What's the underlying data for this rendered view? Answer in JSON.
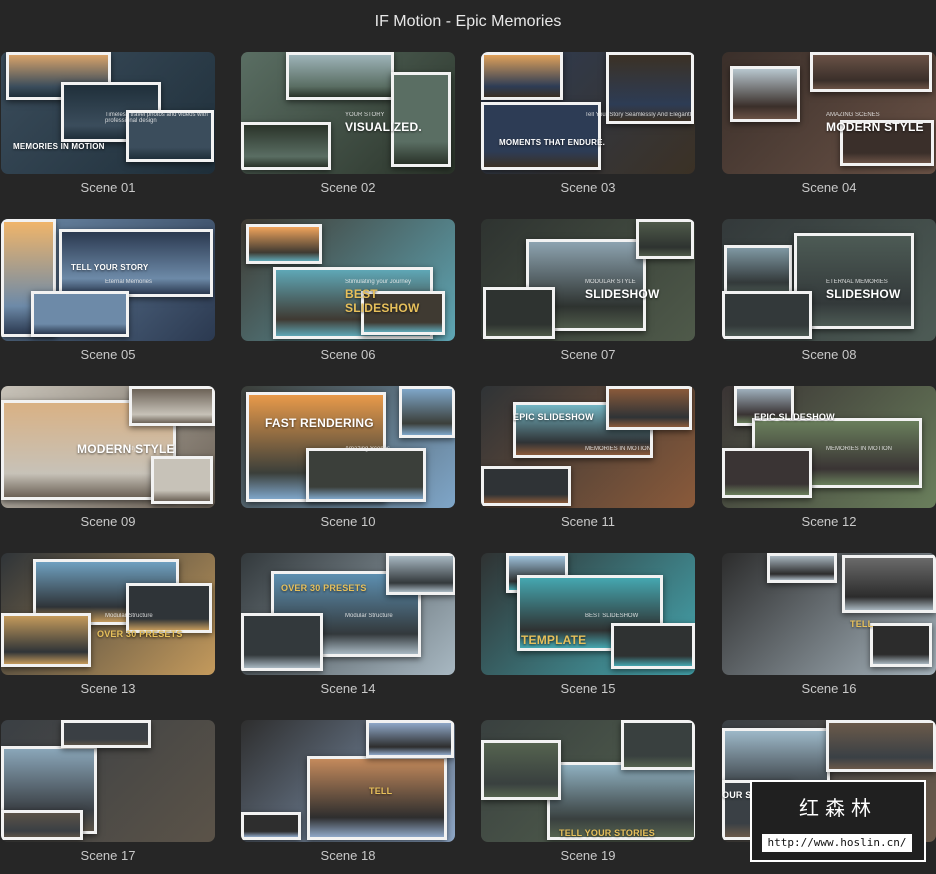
{
  "window": {
    "title": "IF Motion - Epic Memories"
  },
  "scenes": [
    {
      "label": "Scene 01",
      "caption": "MEMORIES IN MOTION",
      "sub": "Timeless travel photos and videos with professional design",
      "theme": [
        "#3b4d5c",
        "#d9a36a",
        "#1f2f3a"
      ]
    },
    {
      "label": "Scene 02",
      "caption": "VISUALIZED.",
      "sub": "YOUR STORY",
      "theme": [
        "#5a6e63",
        "#9db3b8",
        "#2a3329"
      ]
    },
    {
      "label": "Scene 03",
      "caption": "MOMENTS THAT ENDURE.",
      "sub": "Tell Your Story Seamlessly And Elegantly",
      "theme": [
        "#2d3c55",
        "#e0a15a",
        "#3b3125"
      ]
    },
    {
      "label": "Scene 04",
      "caption": "MODERN STYLE",
      "sub": "AMAZING SCENES",
      "theme": [
        "#3a2f2a",
        "#b8c7cf",
        "#6a5246"
      ]
    },
    {
      "label": "Scene 05",
      "caption": "TELL YOUR STORY",
      "sub": "Eternal Memories",
      "theme": [
        "#6d8aa8",
        "#f0b56a",
        "#2b3950"
      ]
    },
    {
      "label": "Scene 06",
      "caption": "BEST SLIDESHOW",
      "sub": "Stimulating your Journey",
      "theme": [
        "#3f3a32",
        "#f0a45c",
        "#5fa7b6"
      ]
    },
    {
      "label": "Scene 07",
      "caption": "SLIDESHOW",
      "sub": "MODULAR STYLE",
      "theme": [
        "#2e3330",
        "#8da3b0",
        "#4f5a4a"
      ]
    },
    {
      "label": "Scene 08",
      "caption": "SLIDESHOW",
      "sub": "ETERNAL MEMORIES",
      "theme": [
        "#33393a",
        "#7f98a3",
        "#4d5b55"
      ]
    },
    {
      "label": "Scene 09",
      "caption": "MODERN STYLE",
      "sub": "Free Lifestyle",
      "theme": [
        "#c7c2b8",
        "#d9b184",
        "#6c6257"
      ]
    },
    {
      "label": "Scene 10",
      "caption": "FAST RENDERING",
      "sub": "Amazing Scenes",
      "theme": [
        "#3b3f3a",
        "#e89a4a",
        "#7fa6c9"
      ]
    },
    {
      "label": "Scene 11",
      "caption": "EPIC SLIDESHOW",
      "sub": "MEMORIES IN MOTION",
      "theme": [
        "#2f3336",
        "#74b6c4",
        "#8a5a3a"
      ]
    },
    {
      "label": "Scene 12",
      "caption": "EPIC SLIDESHOW",
      "sub": "MEMORIES IN MOTION",
      "theme": [
        "#3a3434",
        "#9fb0bd",
        "#6a7f5c"
      ]
    },
    {
      "label": "Scene 13",
      "caption": "OVER 30 PRESETS",
      "sub": "Modular Structure",
      "theme": [
        "#2f3438",
        "#6fa0c0",
        "#c49a5c"
      ]
    },
    {
      "label": "Scene 14",
      "caption": "OVER 30 PRESETS",
      "sub": "Modular Structure",
      "theme": [
        "#33393c",
        "#5d8fb0",
        "#a8b8c2"
      ]
    },
    {
      "label": "Scene 15",
      "caption": "TEMPLATE",
      "sub": "BEST SLIDESHOW",
      "theme": [
        "#2f3232",
        "#9ec1da",
        "#45a7b0"
      ]
    },
    {
      "label": "Scene 16",
      "caption": "TELL",
      "sub": "",
      "theme": [
        "#2c2c2c",
        "#6a6a6a",
        "#a8b6bf"
      ]
    },
    {
      "label": "Scene 17",
      "caption": "",
      "sub": "",
      "theme": [
        "#3a3f44",
        "#8aa6b9",
        "#5b5348"
      ]
    },
    {
      "label": "Scene 18",
      "caption": "TELL",
      "sub": "",
      "theme": [
        "#2e2e2e",
        "#c48a5c",
        "#8fa8c8"
      ]
    },
    {
      "label": "Scene 19",
      "caption": "TELL YOUR STORIES",
      "sub": "",
      "theme": [
        "#39403f",
        "#8fb0c0",
        "#55634f"
      ]
    },
    {
      "label": "Scene 20",
      "caption": "OUR STORIES",
      "sub": "",
      "theme": [
        "#3a4045",
        "#9db8c8",
        "#6b5a4a"
      ]
    }
  ],
  "watermark": {
    "chinese": "红森林",
    "url": "http://www.hoslin.cn/"
  }
}
